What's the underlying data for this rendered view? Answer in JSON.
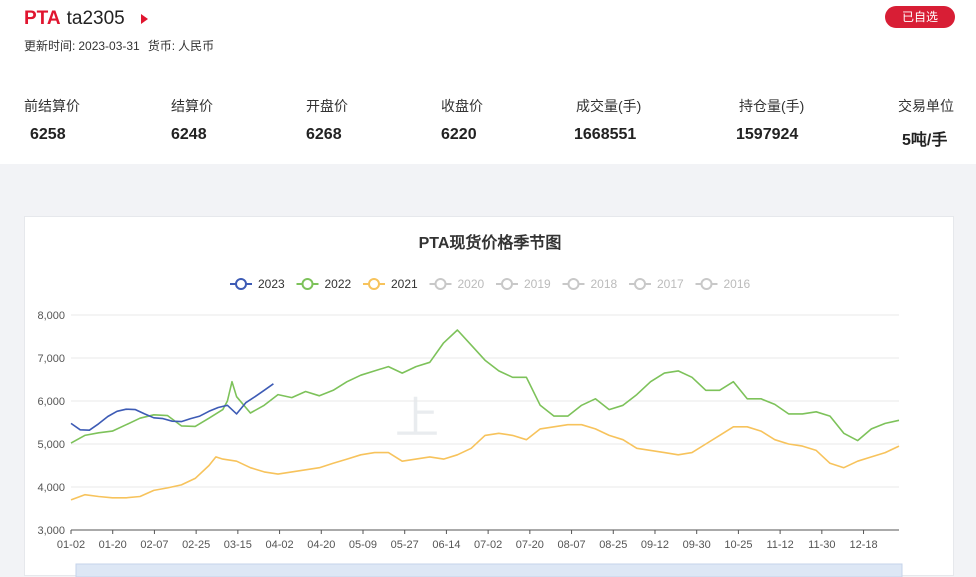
{
  "header": {
    "product": "PTA",
    "contract": "ta2305",
    "update_label": "更新时间:",
    "update_date": "2023-03-31",
    "currency_label": "货币:",
    "currency": "人民币",
    "watch_button": "已自选"
  },
  "stats": [
    {
      "label": "前结算价",
      "value": "6258"
    },
    {
      "label": "结算价",
      "value": "6248"
    },
    {
      "label": "开盘价",
      "value": "6268"
    },
    {
      "label": "收盘价",
      "value": "6220"
    },
    {
      "label": "成交量(手)",
      "value": "1668551"
    },
    {
      "label": "持仓量(手)",
      "value": "1597924"
    },
    {
      "label": "交易单位",
      "value": "5吨/手"
    }
  ],
  "watermark": "上",
  "colors": {
    "accent": "#e0152f",
    "y2023": "#3d5bb5",
    "y2022": "#7dc25a",
    "y2021": "#f7c35c",
    "inactive": "#c8c8c8"
  },
  "chart_data": {
    "type": "line",
    "title": "PTA现货价格季节图",
    "xlabel": "",
    "ylabel": "",
    "ylim": [
      3000,
      8000
    ],
    "yticks": [
      "8,000",
      "7,000",
      "6,000",
      "5,000",
      "4,000",
      "3,000"
    ],
    "yticks_values": [
      8000,
      7000,
      6000,
      5000,
      4000,
      3000
    ],
    "x_tick_labels": [
      "01-02",
      "01-20",
      "02-07",
      "02-25",
      "03-15",
      "04-02",
      "04-20",
      "05-09",
      "05-27",
      "06-14",
      "07-02",
      "07-20",
      "08-07",
      "08-25",
      "09-12",
      "09-30",
      "10-25",
      "11-12",
      "11-30",
      "12-18"
    ],
    "x_range_days": [
      0,
      360
    ],
    "legend": [
      "2023",
      "2022",
      "2021",
      "2020",
      "2019",
      "2018",
      "2017",
      "2016"
    ],
    "legend_active": [
      true,
      true,
      true,
      false,
      false,
      false,
      false,
      false
    ],
    "legend_position": "top-center",
    "series": [
      {
        "name": "2023",
        "x": [
          0,
          4,
          8,
          12,
          16,
          20,
          24,
          28,
          32,
          36,
          40,
          44,
          48,
          52,
          56,
          60,
          64,
          68,
          72,
          76,
          80,
          84,
          88
        ],
        "y": [
          5480,
          5330,
          5320,
          5470,
          5640,
          5760,
          5810,
          5800,
          5700,
          5610,
          5590,
          5530,
          5520,
          5590,
          5650,
          5760,
          5850,
          5900,
          5700,
          5960,
          6100,
          6250,
          6400
        ]
      },
      {
        "name": "2022",
        "x": [
          0,
          6,
          12,
          18,
          24,
          30,
          36,
          42,
          48,
          54,
          60,
          66,
          68,
          70,
          72,
          78,
          84,
          90,
          96,
          102,
          108,
          114,
          120,
          126,
          132,
          138,
          144,
          150,
          156,
          162,
          168,
          174,
          180,
          186,
          192,
          198,
          204,
          210,
          216,
          222,
          228,
          234,
          240,
          246,
          252,
          258,
          264,
          270,
          276,
          282,
          288,
          294,
          300,
          306,
          312,
          318,
          324,
          330,
          336,
          342,
          348,
          354,
          360
        ],
        "y": [
          5020,
          5200,
          5260,
          5300,
          5450,
          5600,
          5680,
          5660,
          5420,
          5410,
          5600,
          5800,
          6000,
          6450,
          6100,
          5720,
          5900,
          6150,
          6080,
          6220,
          6120,
          6250,
          6450,
          6600,
          6700,
          6800,
          6650,
          6800,
          6900,
          7350,
          7650,
          7300,
          6950,
          6700,
          6550,
          6550,
          5900,
          5650,
          5650,
          5900,
          6050,
          5800,
          5900,
          6150,
          6450,
          6650,
          6700,
          6550,
          6250,
          6250,
          6450,
          6050,
          6050,
          5920,
          5700,
          5700,
          5750,
          5650,
          5250,
          5080,
          5350,
          5480,
          5550
        ]
      },
      {
        "name": "2021",
        "x": [
          0,
          6,
          12,
          18,
          24,
          30,
          36,
          42,
          48,
          54,
          60,
          63,
          66,
          72,
          78,
          84,
          90,
          96,
          102,
          108,
          114,
          120,
          126,
          132,
          138,
          144,
          150,
          156,
          162,
          168,
          174,
          180,
          186,
          192,
          198,
          204,
          210,
          216,
          222,
          228,
          234,
          240,
          246,
          252,
          258,
          264,
          270,
          276,
          282,
          288,
          294,
          300,
          306,
          312,
          318,
          324,
          330,
          336,
          342,
          348,
          354,
          360
        ],
        "y": [
          3700,
          3820,
          3780,
          3750,
          3750,
          3780,
          3920,
          3980,
          4050,
          4200,
          4500,
          4700,
          4650,
          4600,
          4450,
          4350,
          4300,
          4350,
          4400,
          4450,
          4550,
          4650,
          4750,
          4800,
          4800,
          4600,
          4650,
          4700,
          4650,
          4750,
          4900,
          5200,
          5250,
          5200,
          5100,
          5350,
          5400,
          5450,
          5450,
          5350,
          5200,
          5100,
          4900,
          4850,
          4800,
          4750,
          4800,
          5000,
          5200,
          5400,
          5400,
          5300,
          5100,
          5000,
          4950,
          4850,
          4550,
          4450,
          4600,
          4700,
          4800,
          4950
        ]
      }
    ]
  }
}
